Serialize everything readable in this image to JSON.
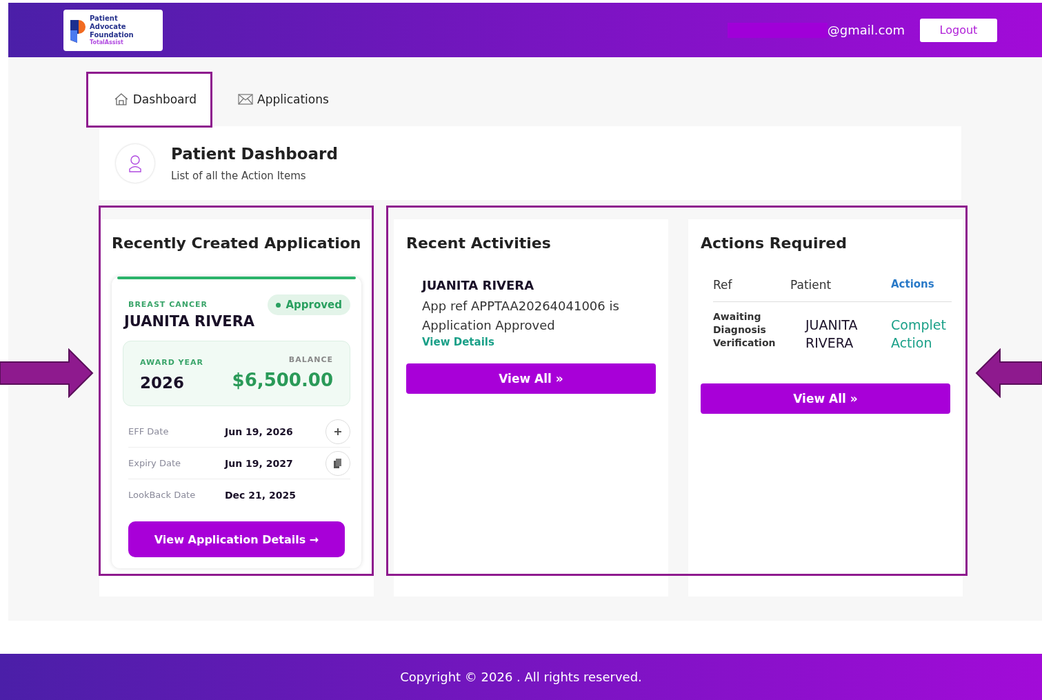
{
  "header": {
    "logo": {
      "title": "Patient Advocate Foundation",
      "subtitle": "TotalAssist"
    },
    "email": "@gmail.com",
    "logout": "Logout"
  },
  "tabs": [
    {
      "label": "Dashboard",
      "selected": true
    },
    {
      "label": "Applications",
      "selected": false
    }
  ],
  "page_header": {
    "title": "Patient Dashboard",
    "subtitle": "List of all the Action Items"
  },
  "recent_application": {
    "title": "Recently Created Application",
    "category": "BREAST CANCER",
    "status": "Approved",
    "patient": "JUANITA RIVERA",
    "award_year_label": "AWARD YEAR",
    "award_year": "2026",
    "balance_label": "BALANCE",
    "balance": "$6,500.00",
    "dates": [
      {
        "label": "EFF Date",
        "value": "Jun 19, 2026"
      },
      {
        "label": "Expiry Date",
        "value": "Jun 19, 2027"
      },
      {
        "label": "LookBack Date",
        "value": "Dec 21, 2025"
      }
    ],
    "button": "View Application Details →"
  },
  "recent_activities": {
    "title": "Recent Activities",
    "items": [
      {
        "name": "JUANITA RIVERA",
        "text": "App ref APPTAA20264041006 is Application Approved",
        "link": "View Details"
      }
    ],
    "button": "View All »"
  },
  "actions_required": {
    "title": "Actions Required",
    "columns": [
      "Ref",
      "Patient",
      "Actions"
    ],
    "rows": [
      {
        "ref": "Awaiting Diagnosis Verification",
        "patient": "JUANITA RIVERA",
        "action": "Complet Action"
      }
    ],
    "button": "View All »"
  },
  "footer": "Copyright © 2026 . All rights reserved."
}
